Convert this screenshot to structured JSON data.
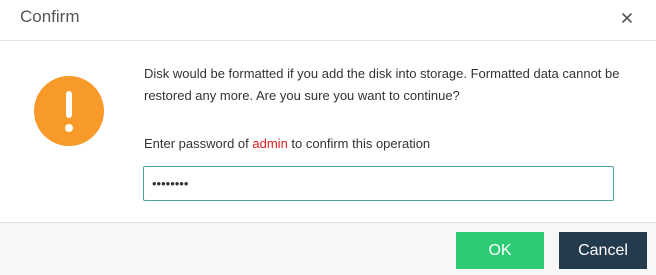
{
  "dialog": {
    "title": "Confirm",
    "close_icon": "close-icon",
    "warning_icon": "exclamation-icon",
    "message": "Disk would be formatted if you add the disk into storage. Formatted data cannot be restored any more. Are you sure you want to continue?",
    "prompt_before": "Enter password of ",
    "prompt_user": "admin",
    "prompt_after": " to confirm this operation",
    "password_value": "••••••••",
    "ok_label": "OK",
    "cancel_label": "Cancel"
  },
  "colors": {
    "warning": "#f79a2a",
    "ok": "#2dcb73",
    "cancel": "#243a4d",
    "input_border": "#4aa79a",
    "highlight": "#e02020"
  }
}
